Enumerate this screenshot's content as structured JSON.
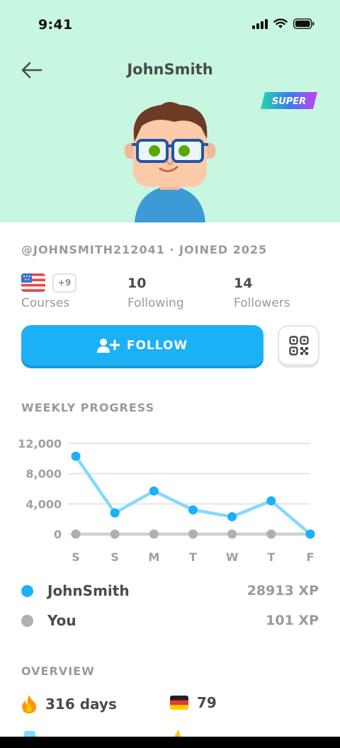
{
  "status": {
    "time": "9:41"
  },
  "header": {
    "title": "JohnSmith",
    "badge": "SUPER"
  },
  "profile": {
    "handle_joined": "@JOHNSMITH212041 · JOINED 2025"
  },
  "stats": {
    "courses_more": "+9",
    "courses_label": "Courses",
    "following_count": "10",
    "following_label": "Following",
    "followers_count": "14",
    "followers_label": "Followers"
  },
  "actions": {
    "follow_label": "FOLLOW"
  },
  "weekly": {
    "title": "WEEKLY PROGRESS"
  },
  "chart_data": {
    "type": "line",
    "categories": [
      "S",
      "S",
      "M",
      "T",
      "W",
      "T",
      "F"
    ],
    "ylim": [
      0,
      12000
    ],
    "yticks": [
      "12,000",
      "8,000",
      "4,000",
      "0"
    ],
    "ytick_values": [
      12000,
      8000,
      4000,
      0
    ],
    "grid": true,
    "series": [
      {
        "name": "JohnSmith",
        "color": "#1cb0f6",
        "values": [
          10300,
          2800,
          5700,
          3200,
          2300,
          4400,
          0
        ]
      },
      {
        "name": "You",
        "color": "#afafaf",
        "values": [
          0,
          0,
          0,
          0,
          0,
          0,
          0
        ]
      }
    ]
  },
  "legend": [
    {
      "name": "JohnSmith",
      "xp": "28913 XP",
      "color": "#1cb0f6"
    },
    {
      "name": "You",
      "xp": "101 XP",
      "color": "#afafaf"
    }
  ],
  "overview": {
    "title": "OVERVIEW",
    "streak": "316 days",
    "german": "79"
  }
}
